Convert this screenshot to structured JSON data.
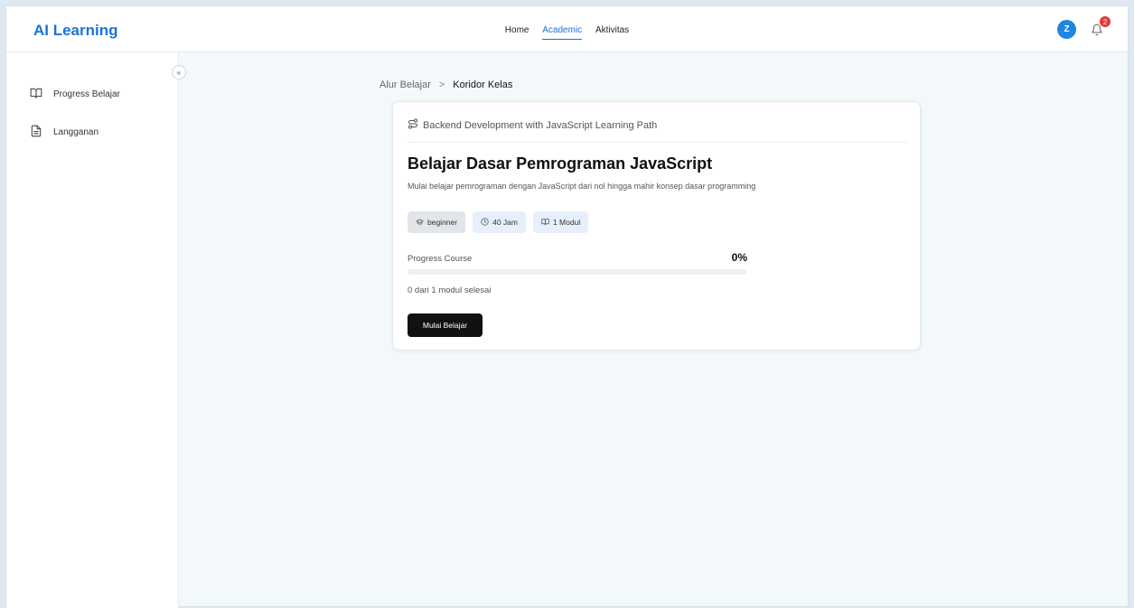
{
  "header": {
    "brand": "AI Learning",
    "nav": [
      {
        "label": "Home",
        "active": false
      },
      {
        "label": "Academic",
        "active": true
      },
      {
        "label": "Aktivitas",
        "active": false
      }
    ],
    "avatar_initial": "Z",
    "notification_count": "2"
  },
  "sidebar": {
    "items": [
      {
        "label": "Progress Belajar",
        "icon": "book-open-icon"
      },
      {
        "label": "Langganan",
        "icon": "file-text-icon"
      }
    ],
    "collapse_icon": "«"
  },
  "breadcrumb": {
    "parent": "Alur Belajar",
    "separator": ">",
    "current": "Koridor Kelas"
  },
  "course": {
    "learning_path": "Backend Development with JavaScript Learning Path",
    "title": "Belajar Dasar Pemrograman JavaScript",
    "description": "Mulai belajar pemrograman dengan JavaScript dari nol hingga mahir konsep dasar programming",
    "badges": {
      "level": "beginner",
      "duration": "40 Jam",
      "modules": "1 Modul"
    },
    "progress_label": "Progress Course",
    "progress_percent_text": "0%",
    "progress_value": 0,
    "progress_summary": "0 dari 1 modul selesai",
    "start_button": "Mulai Belajar"
  },
  "colors": {
    "brand": "#1a73d9",
    "accent": "#1d6fd8",
    "badge_alert": "#e53935",
    "button": "#111111"
  }
}
